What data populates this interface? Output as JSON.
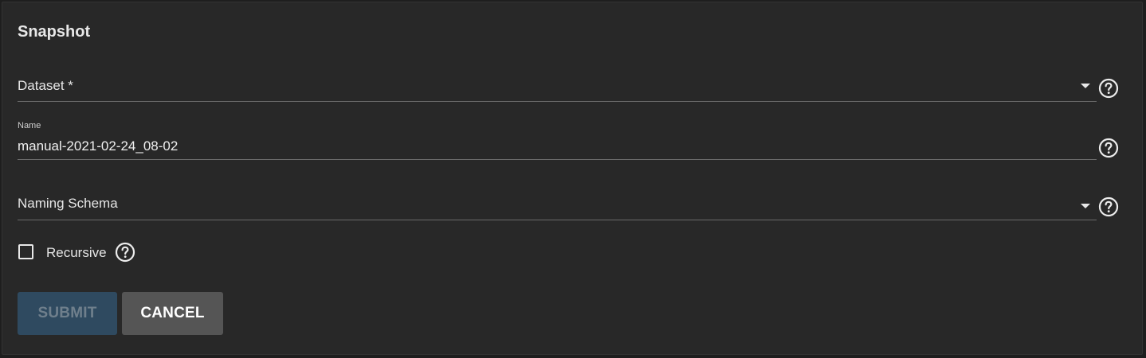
{
  "form": {
    "title": "Snapshot",
    "dataset": {
      "label": "Dataset *",
      "value": ""
    },
    "name": {
      "label": "Name",
      "value": "manual-2021-02-24_08-02"
    },
    "naming_schema": {
      "label": "Naming Schema",
      "value": ""
    },
    "recursive": {
      "label": "Recursive",
      "checked": false
    },
    "buttons": {
      "submit_label": "SUBMIT",
      "cancel_label": "CANCEL"
    }
  },
  "icons": {
    "help": "help-circle-icon",
    "dropdown": "dropdown-arrow-icon"
  },
  "colors": {
    "card_background": "#282828",
    "submit_disabled": "#2f4a60",
    "cancel": "#555555"
  }
}
